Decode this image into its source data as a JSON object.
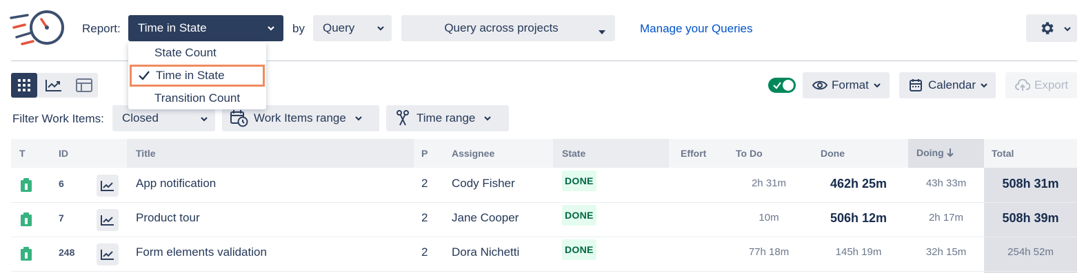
{
  "toolbar": {
    "report_label": "Report:",
    "report_selected": "Time in State",
    "by_label": "by",
    "by_selected": "Query",
    "query_selected": "Query across projects",
    "manage_link": "Manage your Queries"
  },
  "report_dropdown": {
    "options": [
      "State Count",
      "Time in State",
      "Transition Count"
    ],
    "selected_index": 1
  },
  "controls": {
    "format_label": "Format",
    "calendar_label": "Calendar",
    "export_label": "Export",
    "toggle_on": true
  },
  "filter": {
    "label": "Filter Work Items:",
    "status_selected": "Closed",
    "work_items_range_label": "Work Items range",
    "time_range_label": "Time range"
  },
  "table": {
    "headers": {
      "t": "T",
      "id": "ID",
      "title": "Title",
      "p": "P",
      "assignee": "Assignee",
      "state": "State",
      "effort": "Effort",
      "todo": "To Do",
      "done": "Done",
      "doing": "Doing",
      "total": "Total"
    },
    "rows": [
      {
        "id": "6",
        "title": "App notification",
        "p": "2",
        "assignee": "Cody Fisher",
        "state": "DONE",
        "todo": "2h 31m",
        "done": "462h 25m",
        "doing": "43h 33m",
        "total": "508h 31m"
      },
      {
        "id": "7",
        "title": "Product tour",
        "p": "2",
        "assignee": "Jane Cooper",
        "state": "DONE",
        "todo": "10m",
        "done": "506h 12m",
        "doing": "2h 17m",
        "total": "508h 39m"
      },
      {
        "id": "248",
        "title": "Form elements validation",
        "p": "2",
        "assignee": "Dora Nichetti",
        "state": "DONE",
        "todo": "77h 18m",
        "done": "145h 19m",
        "doing": "32h 15m",
        "total": "254h 52m"
      }
    ]
  },
  "colors": {
    "primary_dark": "#2c3e5d",
    "link": "#0052cc",
    "highlight_border": "#f08a5d",
    "done_bg": "#e3fcef",
    "done_text": "#006644",
    "toggle_green": "#00875a",
    "type_icon_green": "#36b37e"
  }
}
